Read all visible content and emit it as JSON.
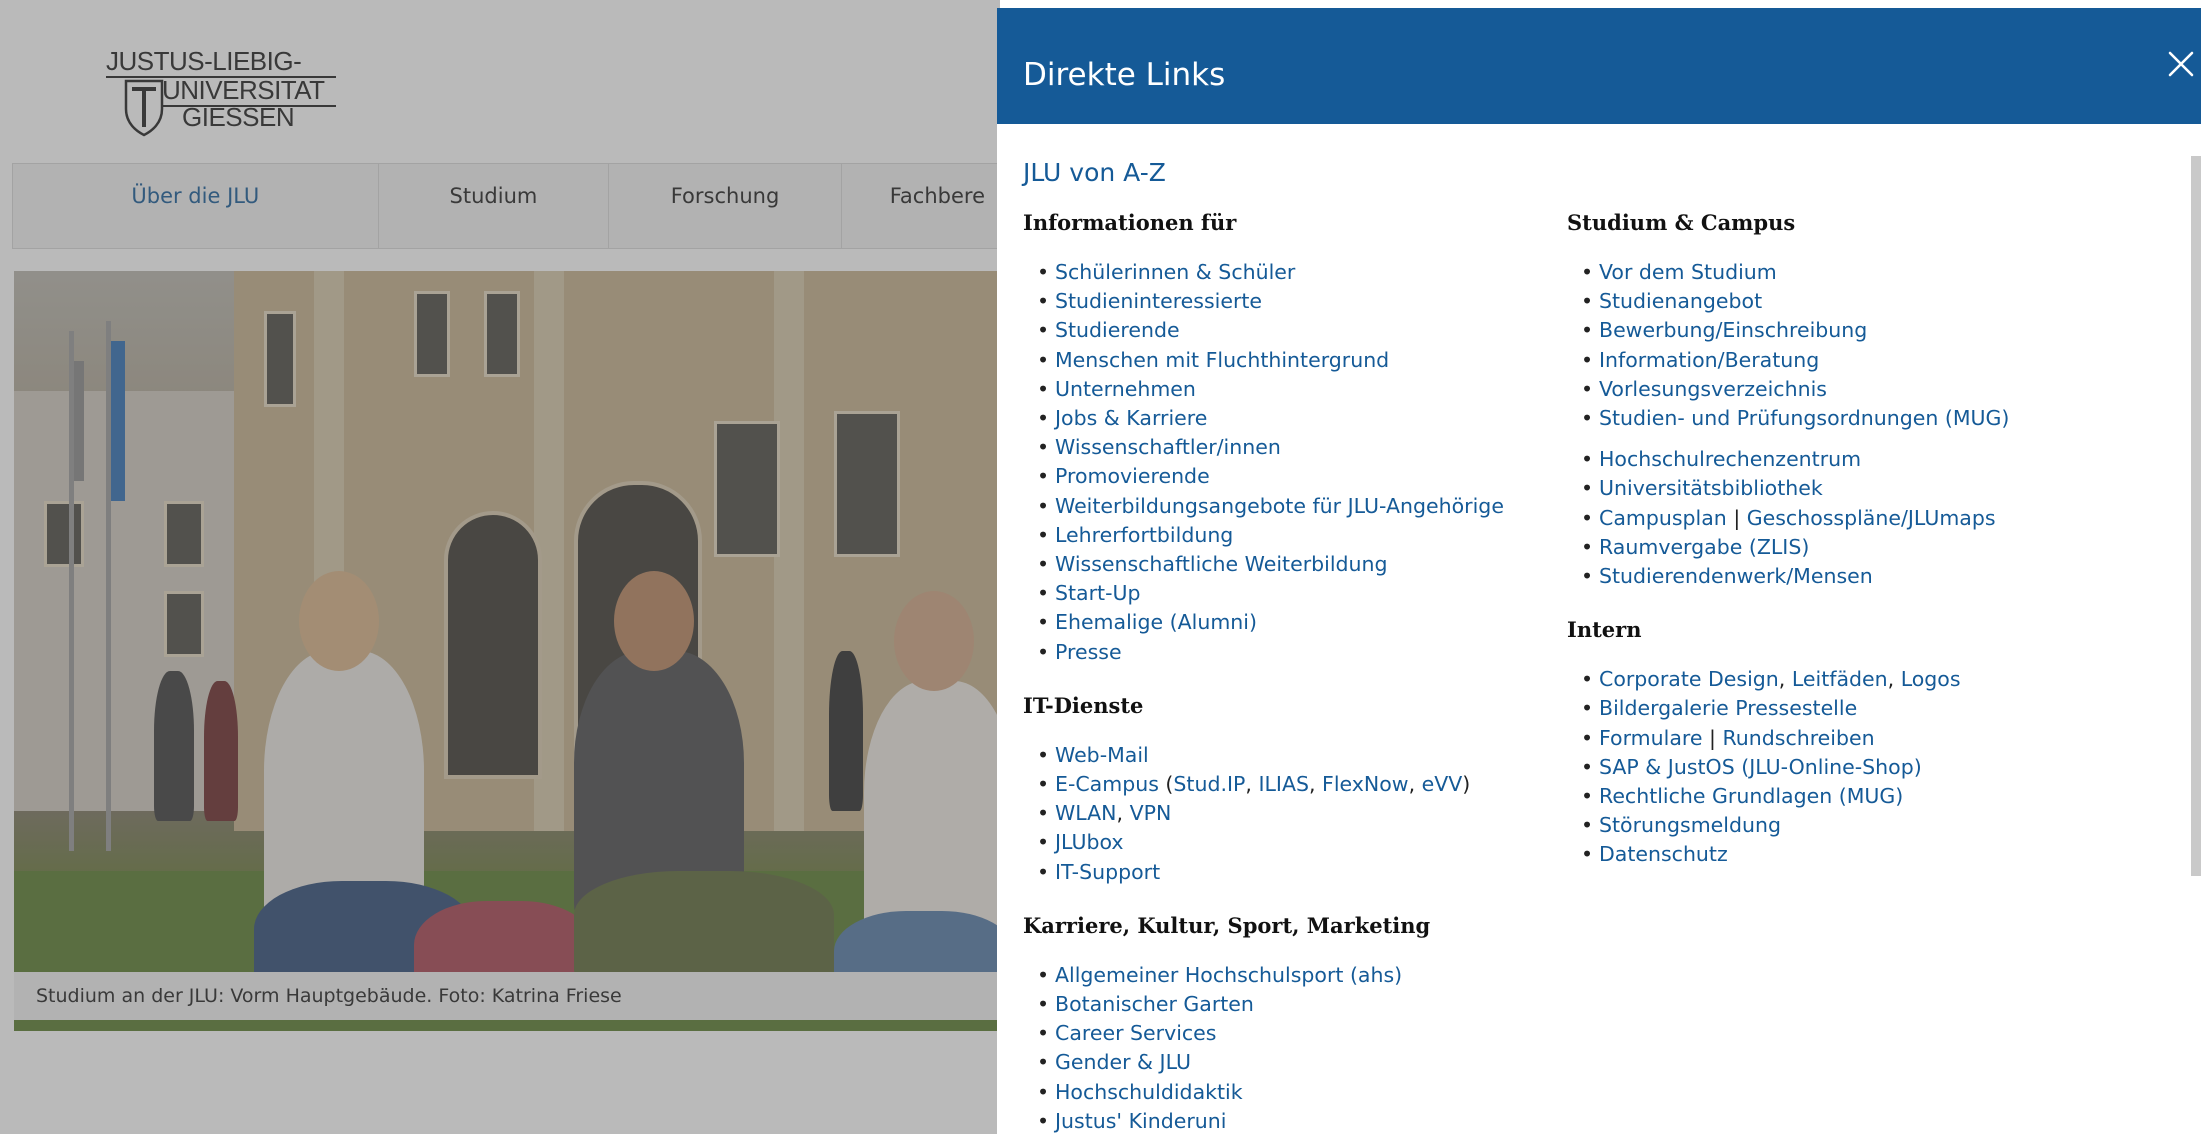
{
  "background_page": {
    "logo": {
      "line1": "JUSTUS-LIEBIG-",
      "line2": "UNIVERSITAT",
      "line3": "GIESSEN"
    },
    "nav": [
      {
        "label": "Über die JLU",
        "active": true
      },
      {
        "label": "Studium",
        "active": false
      },
      {
        "label": "Forschung",
        "active": false
      },
      {
        "label": "Fachbere",
        "active": false
      }
    ],
    "caption": "Studium an der JLU: Vorm Hauptgebäude. Foto: Katrina Friese"
  },
  "panel": {
    "title": "Direkte Links",
    "close_icon": "close-icon",
    "az_link": "JLU von A-Z",
    "colors": {
      "header_bg": "#155a97",
      "link": "#155a97"
    },
    "left_column": {
      "informationen_fuer": {
        "heading": "Informationen für",
        "items": [
          "Schülerinnen & Schüler",
          "Studieninteressierte",
          "Studierende",
          "Menschen mit Fluchthintergrund",
          "Unternehmen",
          "Jobs & Karriere",
          "Wissenschaftler/innen",
          "Promovierende",
          "Weiterbildungsangebote für JLU-Angehörige",
          "Lehrerfortbildung",
          "Wissenschaftliche Weiterbildung",
          "Start-Up",
          "Ehemalige (Alumni)",
          "Presse"
        ]
      },
      "it_dienste": {
        "heading": "IT-Dienste",
        "webmail": "Web-Mail",
        "ecampus": "E-Campus",
        "ecampus_open": " (",
        "studip": "Stud.IP",
        "comma": ", ",
        "ilias": "ILIAS",
        "flexnow": "FlexNow",
        "evv": "eVV",
        "ecampus_close": ")",
        "wlan": "WLAN",
        "vpn": "VPN",
        "jlubox": "JLUbox",
        "itsupport": "IT-Support"
      },
      "karriere": {
        "heading": "Karriere, Kultur, Sport, Marketing",
        "items": [
          "Allgemeiner Hochschulsport (ahs)",
          "Botanischer Garten",
          "Career Services",
          "Gender & JLU",
          "Hochschuldidaktik",
          "Justus' Kinderuni"
        ]
      }
    },
    "right_column": {
      "studium_campus": {
        "heading": "Studium & Campus",
        "items_a": [
          "Vor dem Studium",
          "Studienangebot",
          "Bewerbung/Einschreibung",
          "Information/Beratung",
          "Vorlesungsverzeichnis",
          "Studien- und Prüfungsordnungen (MUG)"
        ],
        "hrz": "Hochschulrechenzentrum",
        "ub": "Universitätsbibliothek",
        "campusplan": "Campusplan",
        "pipe": " | ",
        "geschoss": "Geschosspläne/JLUmaps",
        "raum": "Raumvergabe (ZLIS)",
        "mensen": "Studierendenwerk/Mensen"
      },
      "intern": {
        "heading": "Intern",
        "cd": "Corporate Design",
        "comma": ", ",
        "leitfaeden": "Leitfäden",
        "logos": "Logos",
        "bildergalerie": "Bildergalerie Pressestelle",
        "formulare": "Formulare",
        "pipe": " | ",
        "rundschreiben": "Rundschreiben",
        "sap": "SAP & JustOS (JLU-Online-Shop)",
        "recht": "Rechtliche Grundlagen (MUG)",
        "stoerung": "Störungsmeldung",
        "datenschutz": "Datenschutz"
      }
    }
  }
}
